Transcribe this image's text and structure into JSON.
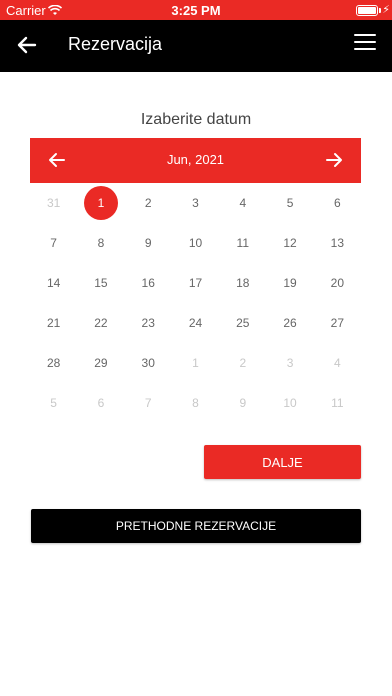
{
  "status_bar": {
    "carrier": "Carrier",
    "time": "3:25 PM"
  },
  "nav": {
    "title": "Rezervacija"
  },
  "calendar": {
    "section_title": "Izaberite datum",
    "month_label": "Jun, 2021",
    "days": [
      {
        "label": "31",
        "muted": true
      },
      {
        "label": "1",
        "selected": true
      },
      {
        "label": "2"
      },
      {
        "label": "3"
      },
      {
        "label": "4"
      },
      {
        "label": "5"
      },
      {
        "label": "6"
      },
      {
        "label": "7"
      },
      {
        "label": "8"
      },
      {
        "label": "9"
      },
      {
        "label": "10"
      },
      {
        "label": "11"
      },
      {
        "label": "12"
      },
      {
        "label": "13"
      },
      {
        "label": "14"
      },
      {
        "label": "15"
      },
      {
        "label": "16"
      },
      {
        "label": "17"
      },
      {
        "label": "18"
      },
      {
        "label": "19"
      },
      {
        "label": "20"
      },
      {
        "label": "21"
      },
      {
        "label": "22"
      },
      {
        "label": "23"
      },
      {
        "label": "24"
      },
      {
        "label": "25"
      },
      {
        "label": "26"
      },
      {
        "label": "27"
      },
      {
        "label": "28"
      },
      {
        "label": "29"
      },
      {
        "label": "30"
      },
      {
        "label": "1",
        "muted": true
      },
      {
        "label": "2",
        "muted": true
      },
      {
        "label": "3",
        "muted": true
      },
      {
        "label": "4",
        "muted": true
      },
      {
        "label": "5",
        "muted": true
      },
      {
        "label": "6",
        "muted": true
      },
      {
        "label": "7",
        "muted": true
      },
      {
        "label": "8",
        "muted": true
      },
      {
        "label": "9",
        "muted": true
      },
      {
        "label": "10",
        "muted": true
      },
      {
        "label": "11",
        "muted": true
      }
    ]
  },
  "actions": {
    "next_label": "DALJE",
    "previous_reservations_label": "PRETHODNE REZERVACIJE"
  },
  "colors": {
    "accent": "#ea2a25",
    "nav_background": "#000000"
  },
  "icons": {
    "back": "arrow-left-icon",
    "menu": "hamburger-menu-icon",
    "prev_month": "arrow-left-icon",
    "next_month": "arrow-right-icon"
  }
}
